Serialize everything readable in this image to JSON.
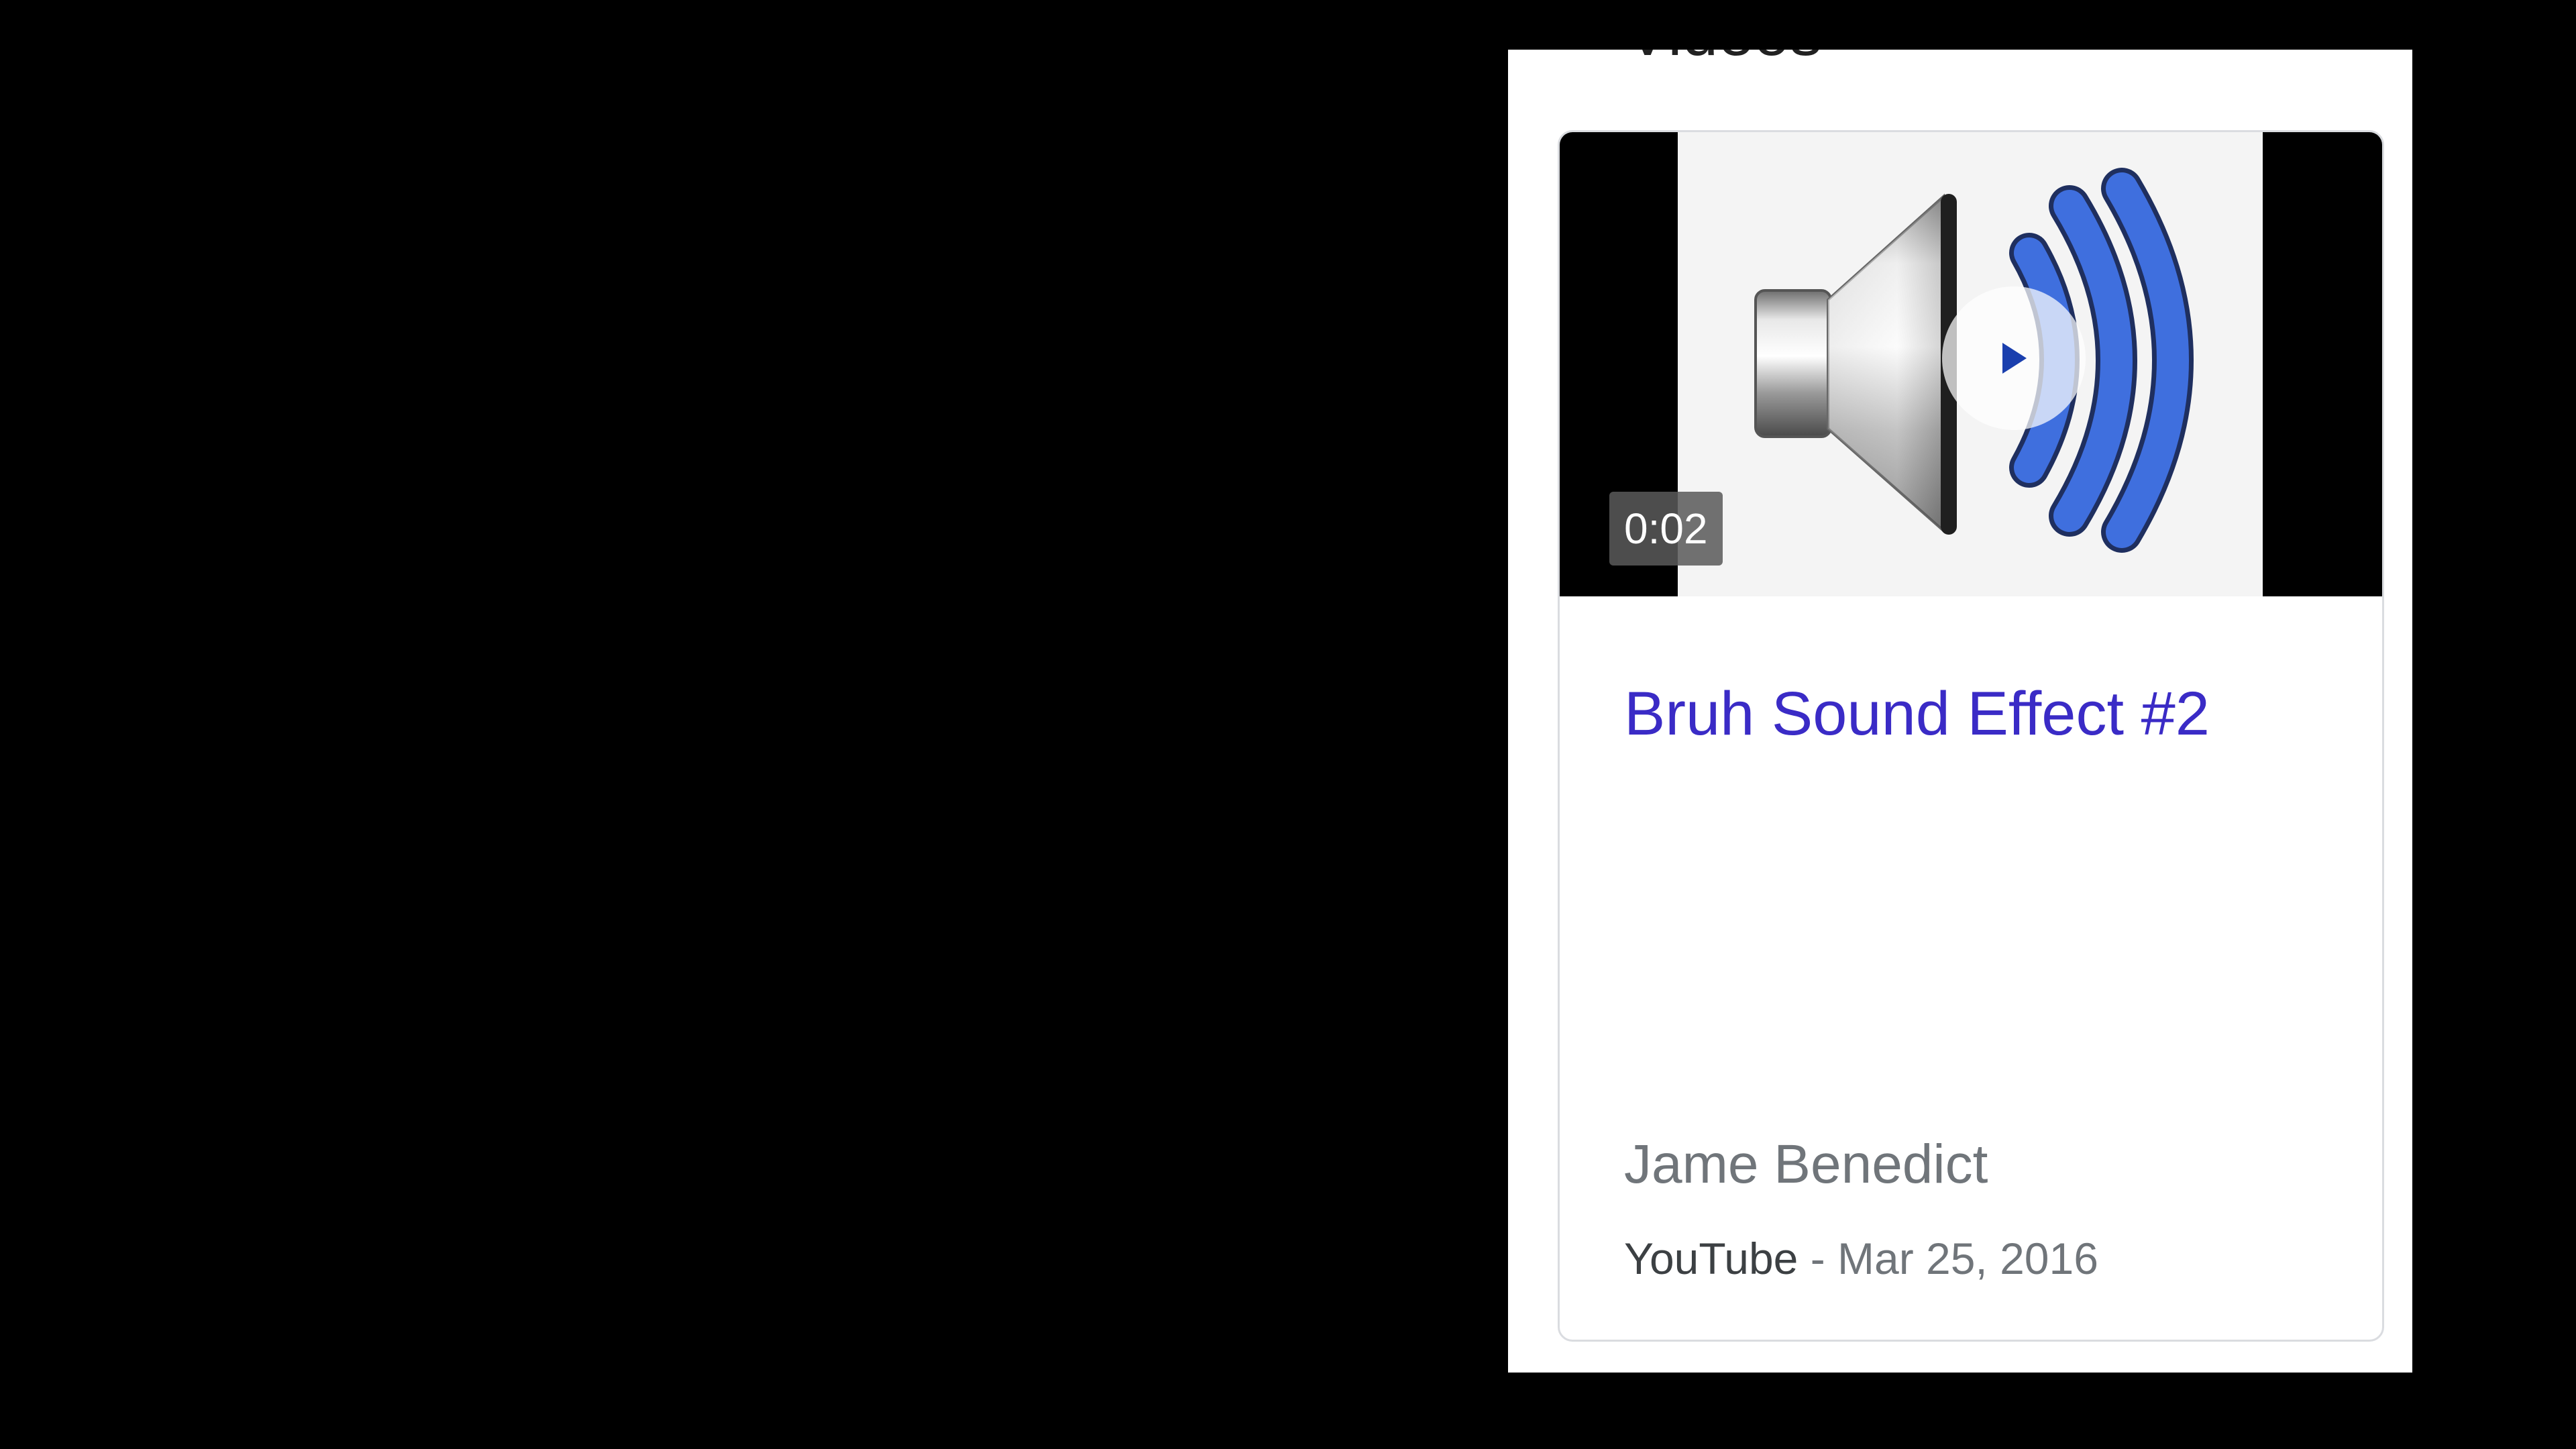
{
  "section": {
    "heading": "Videos"
  },
  "video_card": {
    "title": "Bruh Sound Effect #2",
    "duration": "0:02",
    "channel": "Jame Benedict",
    "source": "YouTube",
    "separator": " - ",
    "date": "Mar 25, 2016",
    "thumbnail_icon": "speaker-volume-icon",
    "play_icon": "play-icon"
  },
  "colors": {
    "title_link": "#3a2bc6",
    "speaker_waves": "#3f6fde",
    "muted_text": "#70757a"
  }
}
